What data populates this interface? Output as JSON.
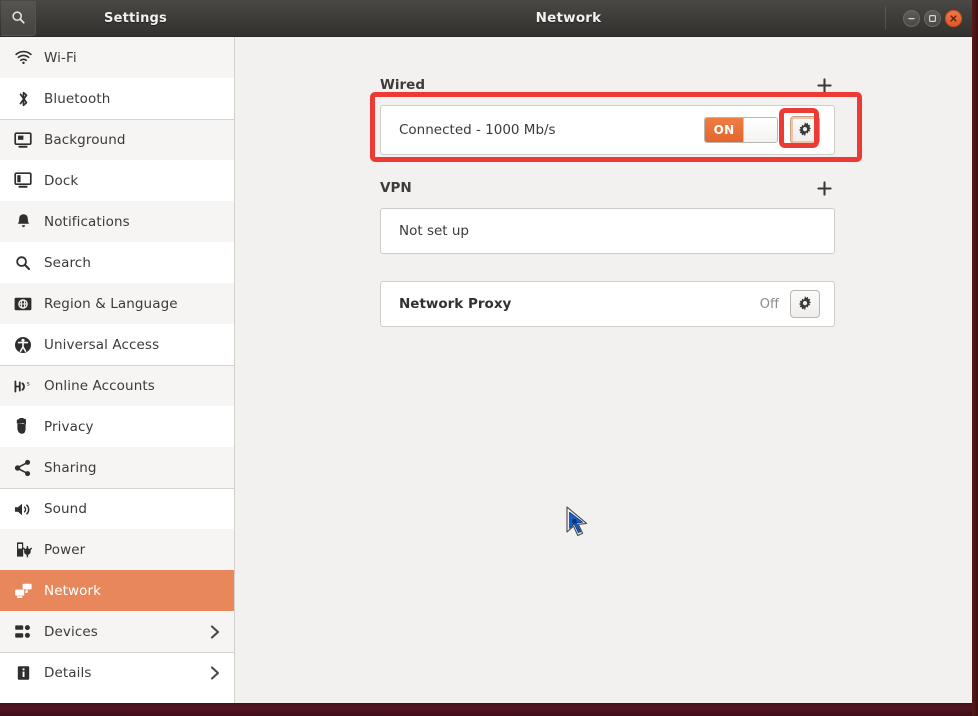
{
  "window": {
    "sidebar_title": "Settings",
    "main_title": "Network",
    "search_icon": "search-icon",
    "minimize_icon": "minimize-icon",
    "maximize_icon": "maximize-icon",
    "close_icon": "close-icon",
    "accent_color": "#e8875c",
    "titlebar_color": "#3d3b37",
    "annotation_color": "#ee3a34"
  },
  "sidebar": {
    "items": [
      {
        "label": "Wi-Fi",
        "icon": "wifi-icon",
        "selected": false,
        "chevron": false
      },
      {
        "label": "Bluetooth",
        "icon": "bluetooth-icon",
        "selected": false,
        "chevron": false
      },
      {
        "label": "Background",
        "icon": "background-icon",
        "selected": false,
        "chevron": false
      },
      {
        "label": "Dock",
        "icon": "dock-icon",
        "selected": false,
        "chevron": false
      },
      {
        "label": "Notifications",
        "icon": "bell-icon",
        "selected": false,
        "chevron": false
      },
      {
        "label": "Search",
        "icon": "search-icon",
        "selected": false,
        "chevron": false
      },
      {
        "label": "Region & Language",
        "icon": "region-language-icon",
        "selected": false,
        "chevron": false
      },
      {
        "label": "Universal Access",
        "icon": "accessibility-icon",
        "selected": false,
        "chevron": false
      },
      {
        "label": "Online Accounts",
        "icon": "online-accounts-icon",
        "selected": false,
        "chevron": false
      },
      {
        "label": "Privacy",
        "icon": "hand-icon",
        "selected": false,
        "chevron": false
      },
      {
        "label": "Sharing",
        "icon": "share-icon",
        "selected": false,
        "chevron": false
      },
      {
        "label": "Sound",
        "icon": "speaker-icon",
        "selected": false,
        "chevron": false
      },
      {
        "label": "Power",
        "icon": "power-icon",
        "selected": false,
        "chevron": false
      },
      {
        "label": "Network",
        "icon": "network-icon",
        "selected": true,
        "chevron": false
      },
      {
        "label": "Devices",
        "icon": "devices-icon",
        "selected": false,
        "chevron": true
      },
      {
        "label": "Details",
        "icon": "info-icon",
        "selected": false,
        "chevron": true
      }
    ]
  },
  "main": {
    "wired": {
      "title": "Wired",
      "add_icon": "plus-icon",
      "status": "Connected - 1000 Mb/s",
      "toggle_state": "ON",
      "settings_icon": "gear-icon"
    },
    "vpn": {
      "title": "VPN",
      "add_icon": "plus-icon",
      "status": "Not set up"
    },
    "proxy": {
      "title": "Network Proxy",
      "state": "Off",
      "settings_icon": "gear-icon"
    }
  },
  "cursor": {
    "icon": "arrow-pointer-cursor"
  }
}
